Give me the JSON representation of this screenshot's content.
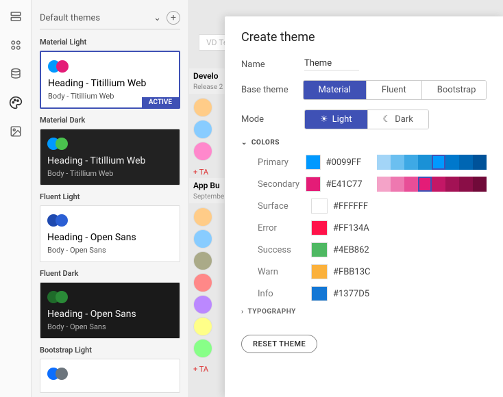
{
  "sidebar": {
    "dropdown": "Default themes",
    "sections": [
      {
        "label": "Material Light",
        "heading": "Heading - Titillium Web",
        "body": "Body - Titillium Web",
        "active": true,
        "dark": false,
        "c1": "#0099ff",
        "c2": "#e41c77"
      },
      {
        "label": "Material Dark",
        "heading": "Heading - Titillium Web",
        "body": "Body - Titillium Web",
        "active": false,
        "dark": true,
        "c1": "#0099ff",
        "c2": "#4ac24e"
      },
      {
        "label": "Fluent Light",
        "heading": "Heading - Open Sans",
        "body": "Body - Open Sans",
        "active": false,
        "dark": false,
        "c1": "#1f4ab0",
        "c2": "#2b5fd4"
      },
      {
        "label": "Fluent Dark",
        "heading": "Heading - Open Sans",
        "body": "Body - Open Sans",
        "active": false,
        "dark": true,
        "c1": "#1f6b2a",
        "c2": "#2a8a37"
      },
      {
        "label": "Bootstrap Light",
        "heading": "",
        "body": "",
        "active": false,
        "dark": false,
        "c1": "#0d6efd",
        "c2": "#6c757d"
      }
    ],
    "activeBadge": "ACTIVE"
  },
  "bg": {
    "tab": "VD Te",
    "groups": [
      {
        "title": "Develo",
        "sub": "Release 2",
        "avatars": [
          "#fc8",
          "#8cf",
          "#f8c"
        ],
        "plus": "TA"
      },
      {
        "title": "App Bu",
        "sub": "Septembe",
        "avatars": [
          "#fc8",
          "#8cf",
          "#aa8",
          "#f88",
          "#b8f",
          "#ff8",
          "#8f8"
        ],
        "plus": "TA"
      }
    ]
  },
  "panel": {
    "title": "Create theme",
    "nameLabel": "Name",
    "nameValue": "Theme",
    "baseLabel": "Base theme",
    "baseOptions": [
      "Material",
      "Fluent",
      "Bootstrap"
    ],
    "baseSelected": 0,
    "modeLabel": "Mode",
    "modeOptions": [
      "Light",
      "Dark"
    ],
    "modeSelected": 0,
    "colorsHead": "COLORS",
    "typoHead": "TYPOGRAPHY",
    "resetLabel": "RESET THEME",
    "colors": [
      {
        "name": "Primary",
        "value": "#0099FF",
        "palette": [
          "#a3d5f7",
          "#6bbff0",
          "#3ea9e5",
          "#1a91d6",
          "#0099ff",
          "#0078cc",
          "#0066b3",
          "#005299"
        ],
        "sel": 4
      },
      {
        "name": "Secondary",
        "value": "#E41C77",
        "palette": [
          "#f4a3c8",
          "#ee78b0",
          "#e84e97",
          "#e41c77",
          "#c31766",
          "#a31255",
          "#8a0e47",
          "#700a39"
        ],
        "sel": 3
      },
      {
        "name": "Surface",
        "value": "#FFFFFF"
      },
      {
        "name": "Error",
        "value": "#FF134A"
      },
      {
        "name": "Success",
        "value": "#4EB862"
      },
      {
        "name": "Warn",
        "value": "#FBB13C"
      },
      {
        "name": "Info",
        "value": "#1377D5"
      }
    ]
  }
}
